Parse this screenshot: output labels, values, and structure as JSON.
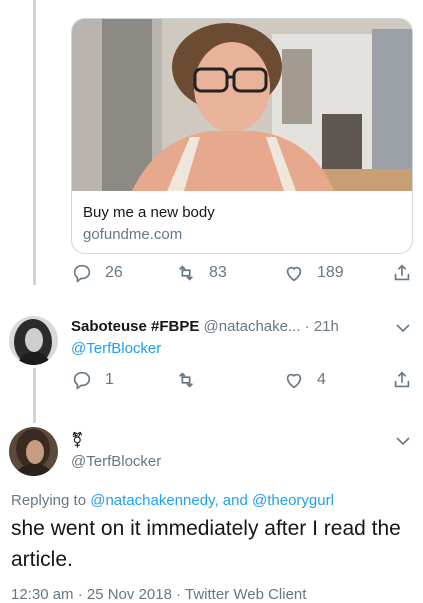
{
  "link_card": {
    "title": "Buy me a new body",
    "domain": "gofundme.com"
  },
  "tweet1_actions": {
    "replies": "26",
    "retweets": "83",
    "likes": "189"
  },
  "tweet2": {
    "name": "Saboteuse #FBPE",
    "handle": "@natachake...",
    "time": "· 21h",
    "reply_to": "@TerfBlocker",
    "replies": "1",
    "retweets": "",
    "likes": "4"
  },
  "tweet3": {
    "name": "⚧",
    "handle": "@TerfBlocker",
    "replying_prefix": "Replying to",
    "replying_user1": "@natachakennedy",
    "replying_and": ", and",
    "replying_user2": "@theorygurl",
    "text": "she went on it immediately after I read the article.",
    "timestamp": "12:30 am · 25 Nov 2018 · Twitter Web Client"
  },
  "colors": {
    "link_blue": "#1da1f2",
    "secondary_text": "#657786",
    "divider": "#ccd6dd"
  }
}
